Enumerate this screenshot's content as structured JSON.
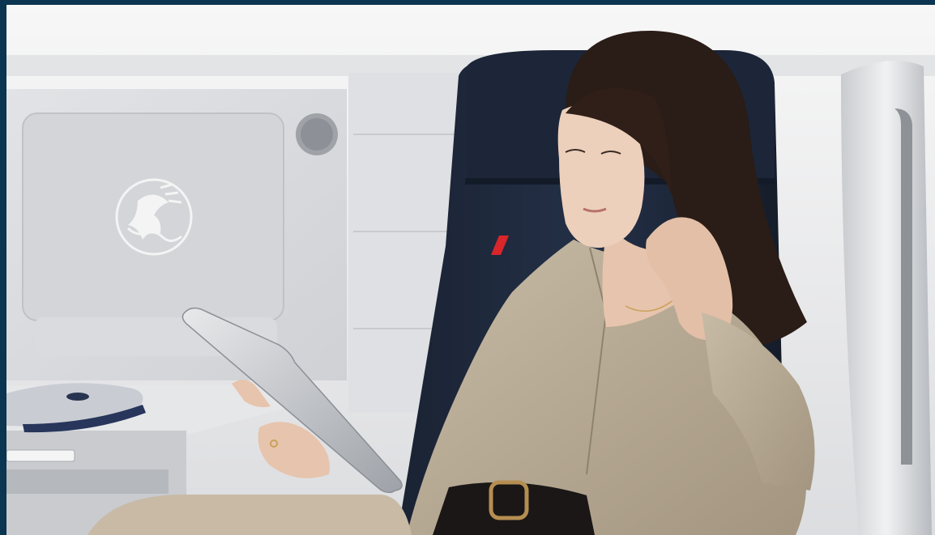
{
  "scene": {
    "type": "photograph",
    "subject": "woman-reading-tablet-in-business-class-seat"
  },
  "colors": {
    "border": "#0b3550",
    "wall": "#e9eaec",
    "panel": "#d7d9dc",
    "seat": "#1b2535",
    "shirt": "#b8ab95",
    "accent_red": "#d8262b"
  },
  "logo": {
    "icon": "winged-seahorse-emblem"
  }
}
